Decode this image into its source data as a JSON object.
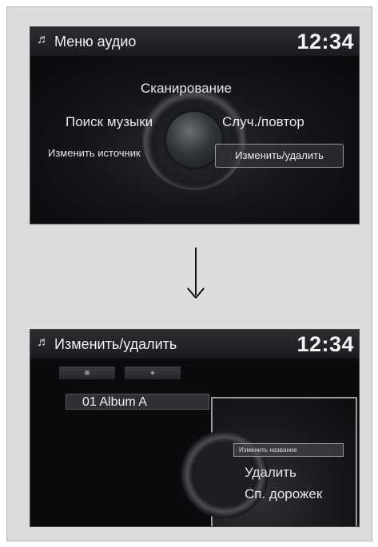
{
  "screen1": {
    "title": "Меню аудио",
    "clock": "12:34",
    "title_icon": "music-note-icon",
    "menu": {
      "scan": "Сканирование",
      "search": "Поиск музыки",
      "shuffle": "Случ./повтор",
      "source": "Изменить источник",
      "edit_delete": "Изменить/удалить"
    },
    "selected_item": "edit_delete"
  },
  "transition_icon": "down-arrow-icon",
  "screen2": {
    "title": "Изменить/удалить",
    "clock": "12:34",
    "title_icon": "music-note-icon",
    "tabs": [
      "folder-icon",
      "artist-icon"
    ],
    "list": [
      "01 Album A"
    ],
    "popup": {
      "rename": "Изменить название",
      "delete": "Удалить",
      "tracks": "Сп. дорожек"
    },
    "selected_item": "rename"
  },
  "colors": {
    "screen_bg": "#0b0c0e",
    "frame_bg": "#dcdcdc",
    "text": "#e8e8e8",
    "highlight_border": "#9a9a9a"
  }
}
